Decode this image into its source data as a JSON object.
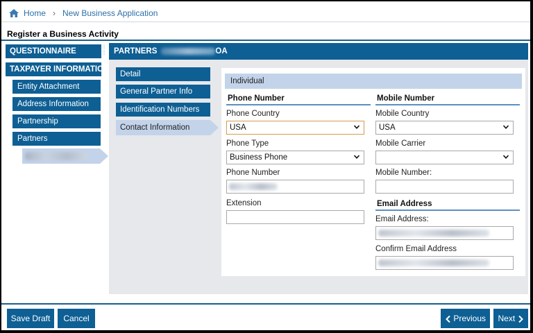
{
  "breadcrumb": {
    "home": "Home",
    "separator": "›",
    "current": "New Business Application"
  },
  "page_title": "Register a Business Activity",
  "sidebar": {
    "questionnaire": "QUESTIONNAIRE",
    "taxpayer": "TAXPAYER INFORMATION",
    "items": [
      {
        "label": "Entity Attachment"
      },
      {
        "label": "Address Information"
      },
      {
        "label": "Partnership"
      },
      {
        "label": "Partners"
      }
    ]
  },
  "partners_header": {
    "prefix": "PARTNERS",
    "suffix": "OA"
  },
  "sub_tabs": [
    {
      "label": "Detail"
    },
    {
      "label": "General Partner Info"
    },
    {
      "label": "Identification Numbers"
    },
    {
      "label": "Contact Information"
    }
  ],
  "form": {
    "individual_label": "Individual",
    "phone_section": "Phone Number",
    "mobile_section": "Mobile Number",
    "email_section": "Email Address",
    "phone_country_label": "Phone Country",
    "phone_country_value": "USA",
    "phone_type_label": "Phone Type",
    "phone_type_value": "Business Phone",
    "phone_number_label": "Phone Number",
    "extension_label": "Extension",
    "mobile_country_label": "Mobile Country",
    "mobile_country_value": "USA",
    "mobile_carrier_label": "Mobile Carrier",
    "mobile_carrier_value": "",
    "mobile_number_label": "Mobile Number:",
    "email_label": "Email Address:",
    "confirm_email_label": "Confirm Email Address"
  },
  "footer": {
    "save_draft": "Save Draft",
    "cancel": "Cancel",
    "previous": "Previous",
    "next": "Next"
  },
  "colors": {
    "primary": "#0e5f94",
    "highlight": "#c3d3ea",
    "panel": "#e6e8eb",
    "focus_border": "#d59a4b"
  },
  "icons": {
    "home": "home-icon",
    "chevron_down": "chevron-down-icon",
    "chevron_left": "chevron-left-icon",
    "chevron_right": "chevron-right-icon"
  }
}
